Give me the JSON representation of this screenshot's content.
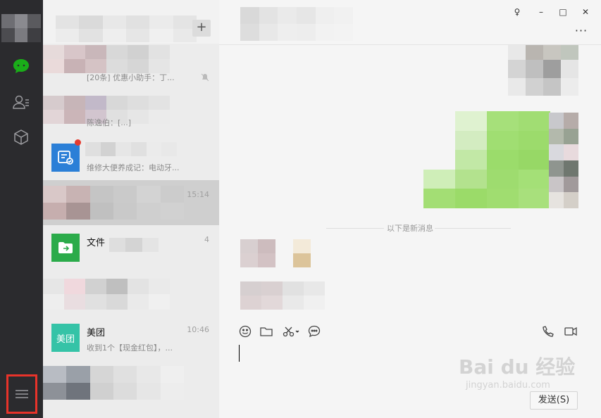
{
  "colors": {
    "rail_bg": "#2b2b2e",
    "chat_active": "#1aad19",
    "highlight_box": "#e8332a",
    "list_bg": "#ececec",
    "selected_row": "#cfcfcf",
    "bubble_green": "#9eea6a",
    "meituan_teal": "#35c3a7",
    "file_green": "#2bab4a",
    "service_blue": "#2b7fd7"
  },
  "rail": {
    "icons": [
      "chat-icon",
      "contacts-icon",
      "favorites-icon",
      "menu-icon"
    ]
  },
  "search": {
    "add_label": "+"
  },
  "conversations": [
    {
      "title": "",
      "preview": "[20条] 优惠小助手：丁...",
      "time": "",
      "muted": true
    },
    {
      "title": "",
      "preview": "陈逸伯：[...]",
      "time": "",
      "muted": false
    },
    {
      "title": "",
      "preview": "维修大便养成记：电动牙...",
      "time": "",
      "muted": false
    },
    {
      "title": "",
      "preview": "",
      "time": "15:14",
      "selected": true
    },
    {
      "title": "文件",
      "preview": "",
      "time": "4"
    },
    {
      "title": "",
      "preview": "",
      "time": ""
    },
    {
      "title": "美团",
      "icon_text": "美团",
      "preview": "收到1个【现金红包】，...",
      "time": "10:46"
    },
    {
      "title": "",
      "preview": "",
      "time": ""
    }
  ],
  "window": {
    "pin": "♀",
    "minimize": "–",
    "maximize": "□",
    "close": "✕",
    "more": "···"
  },
  "chat": {
    "divider": "以下是新消息",
    "send_label": "发送(S)"
  },
  "toolbar": {
    "icons": [
      "emoji-icon",
      "folder-icon",
      "scissors-icon",
      "chat-bubble-icon",
      "phone-icon",
      "video-icon"
    ]
  },
  "watermark": {
    "main": "Bai du 经验",
    "sub": "jingyan.baidu.com"
  }
}
